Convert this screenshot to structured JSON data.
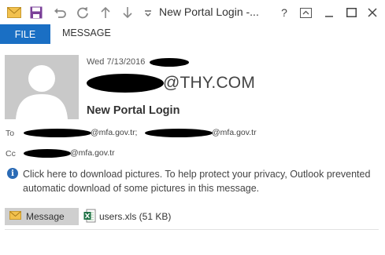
{
  "titlebar": {
    "title": "New Portal Login -...",
    "icons": [
      "mail-icon",
      "save-icon",
      "undo-icon",
      "redo-icon",
      "up-arrow-icon",
      "down-arrow-icon"
    ],
    "help_label": "?",
    "window_buttons": [
      "ribbon-display-icon",
      "minimize-icon",
      "maximize-icon",
      "close-icon"
    ]
  },
  "ribbon": {
    "file_tab": "FILE",
    "message_tab": "MESSAGE"
  },
  "header": {
    "date": "Wed 7/13/2016",
    "sender_domain": "@THY.COM",
    "subject": "New Portal Login",
    "to_label": "To",
    "to_addr1_domain": "@mfa.gov.tr;",
    "to_addr2_domain": "@mfa.gov.tr",
    "cc_label": "Cc",
    "cc_addr_domain": "@mfa.gov.tr"
  },
  "info": {
    "text": "Click here to download pictures. To help protect your privacy, Outlook prevented automatic download of some pictures in this message."
  },
  "attachments": {
    "message_button": "Message",
    "file": "users.xls (51 KB)"
  },
  "colors": {
    "accent": "#1a6fc4",
    "info_icon": "#2b6bb5",
    "excel_green": "#1e7145"
  }
}
